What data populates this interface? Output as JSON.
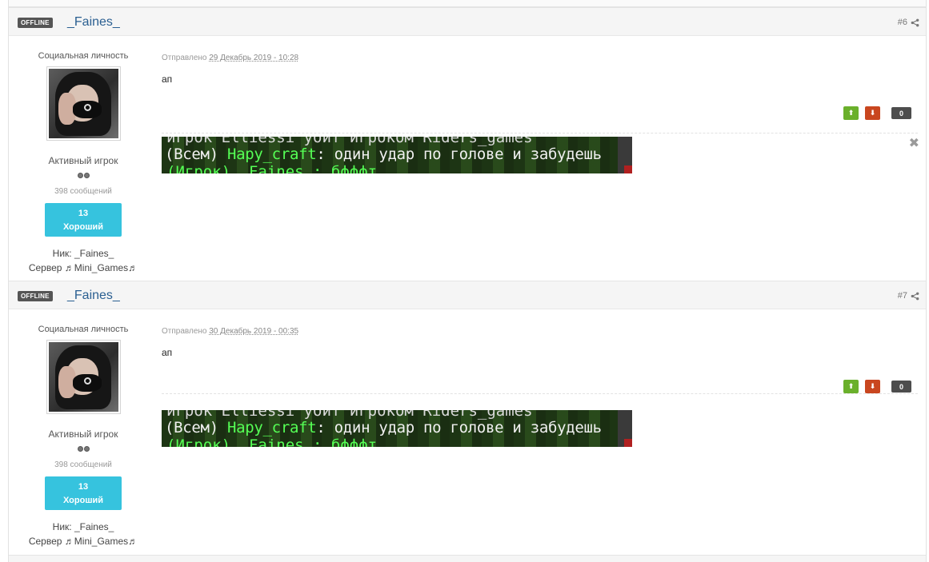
{
  "posts": [
    {
      "status_badge": "OFFLINE",
      "username": "_Faines_",
      "post_number": "#6",
      "rank_title": "Социальная личность",
      "group_name": "Активный игрок",
      "post_count": "398 сообщений",
      "reputation_value": "13",
      "reputation_label": "Хороший",
      "nick_field": "Ник: _Faines_",
      "server_field": "Сервер ♬Mini_Games♬",
      "posted_prefix": "Отправлено",
      "posted_date": "29 Декабрь 2019 - 10:28",
      "text": "ап",
      "rep_count": "0",
      "signature": {
        "line_top": "игрок Elliessi убит игроком Riders_games",
        "prefix": "(Всем) ",
        "name": "Hapy_craft",
        "message": ": один удар по голове и забудешь",
        "line_bottom": "(Игрок) _Faines_: бфффт"
      }
    },
    {
      "status_badge": "OFFLINE",
      "username": "_Faines_",
      "post_number": "#7",
      "rank_title": "Социальная личность",
      "group_name": "Активный игрок",
      "post_count": "398 сообщений",
      "reputation_value": "13",
      "reputation_label": "Хороший",
      "nick_field": "Ник: _Faines_",
      "server_field": "Сервер ♬Mini_Games♬",
      "posted_prefix": "Отправлено",
      "posted_date": "30 Декабрь 2019 - 00:35",
      "text": "ап",
      "rep_count": "0",
      "signature": {
        "line_top": "игрок Elliessi убит игроком Riders_games",
        "prefix": "(Всем) ",
        "name": "Hapy_craft",
        "message": ": один удар по голове и забудешь",
        "line_bottom": "(Игрок) _Faines_: бфффт"
      }
    }
  ],
  "icons": {
    "share": "share-icon",
    "rep_up": "arrow-up-icon",
    "rep_down": "arrow-down-icon",
    "close": "close-icon"
  },
  "colors": {
    "username": "#2a5f91",
    "reputation": "#36c3de",
    "rep_up": "#6ab02b",
    "rep_down": "#c9461f"
  }
}
